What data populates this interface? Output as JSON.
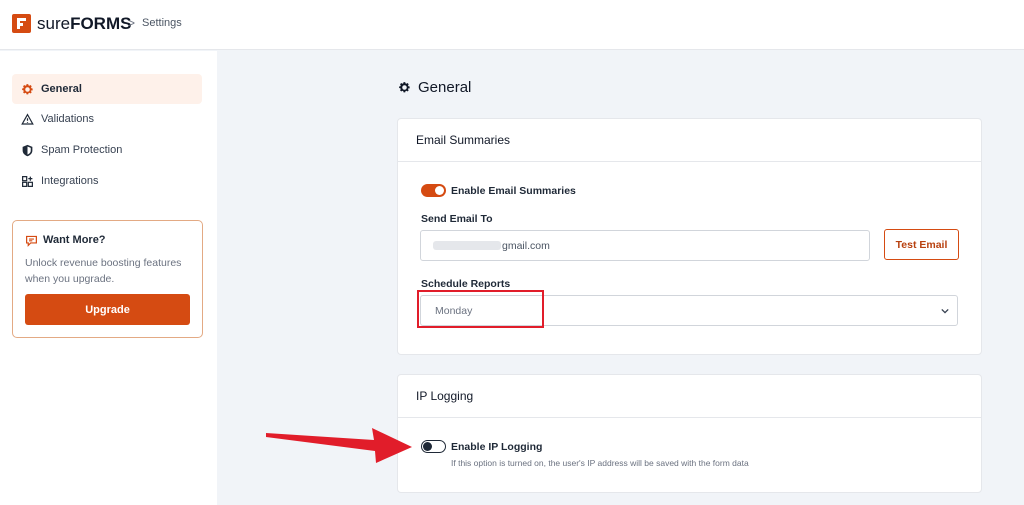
{
  "header": {
    "brand_light": "sure",
    "brand_bold": "FORMS",
    "separator": ">",
    "breadcrumb": "Settings"
  },
  "sidebar": {
    "items": [
      {
        "label": "General",
        "icon": "gear-icon",
        "active": true
      },
      {
        "label": "Validations",
        "icon": "warning-triangle-icon",
        "active": false
      },
      {
        "label": "Spam Protection",
        "icon": "shield-icon",
        "active": false
      },
      {
        "label": "Integrations",
        "icon": "grid-plus-icon",
        "active": false
      }
    ],
    "promo": {
      "title": "Want More?",
      "text": "Unlock revenue boosting features when you upgrade.",
      "button": "Upgrade"
    }
  },
  "main": {
    "title": "General",
    "email_summaries": {
      "heading": "Email Summaries",
      "toggle_label": "Enable Email Summaries",
      "toggle_on": true,
      "send_to_label": "Send Email To",
      "send_to_value_visible": "gmail.com",
      "test_button": "Test Email",
      "schedule_label": "Schedule Reports",
      "schedule_value": "Monday"
    },
    "ip_logging": {
      "heading": "IP Logging",
      "toggle_label": "Enable IP Logging",
      "toggle_on": false,
      "help_text": "If this option is turned on, the user's IP address will be saved with the form data"
    }
  },
  "colors": {
    "accent": "#d54b12",
    "annotation_red": "#e11d2a",
    "background": "#f1f4f8"
  }
}
